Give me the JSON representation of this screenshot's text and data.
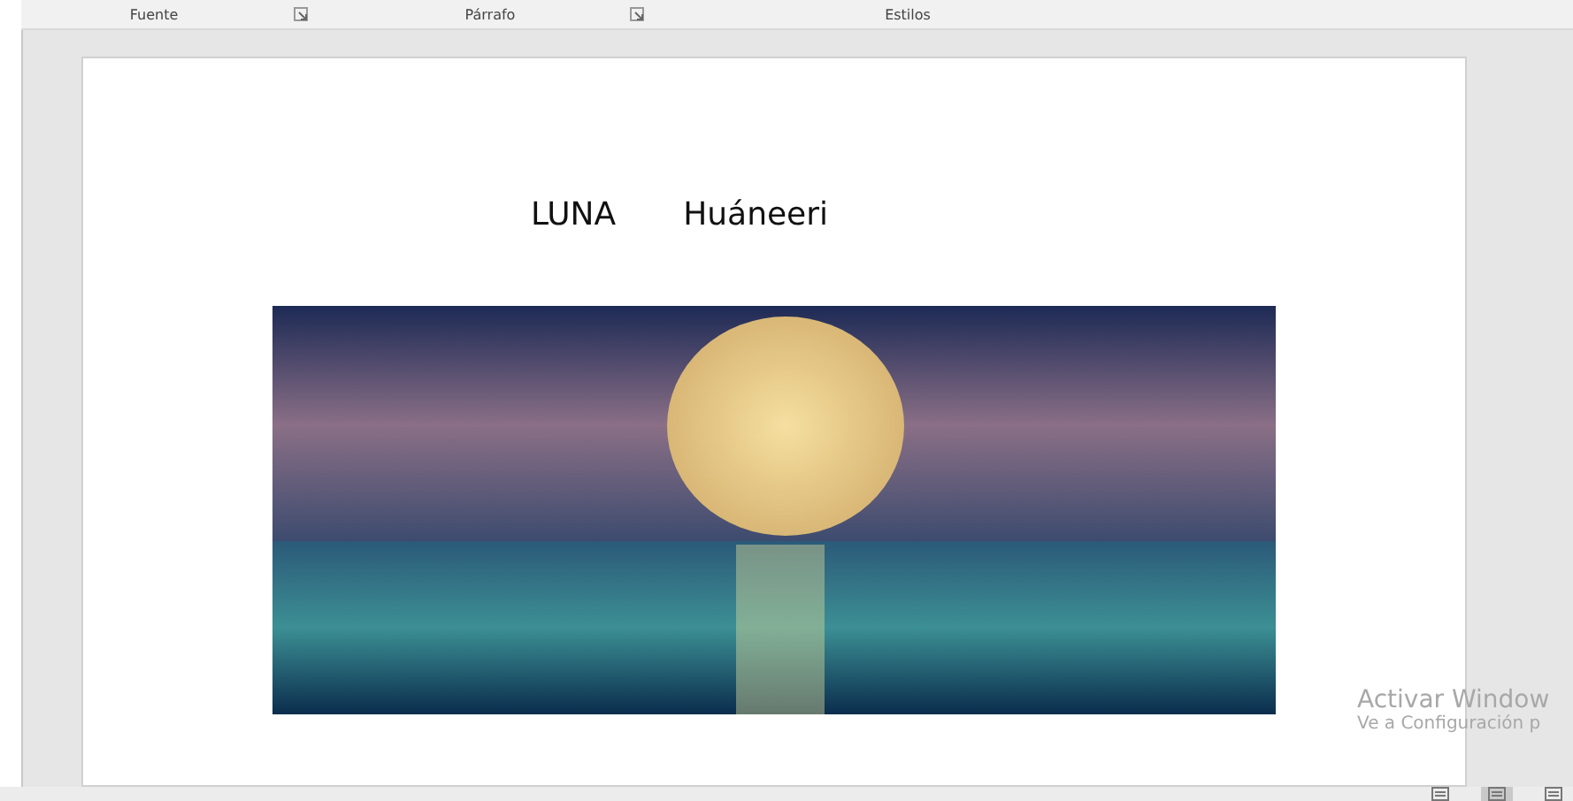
{
  "ribbon_groups": [
    {
      "label": "Fuente",
      "launcher": true
    },
    {
      "label": "Párrafo",
      "launcher": true
    },
    {
      "label": "Estilos",
      "launcher": false
    }
  ],
  "document": {
    "title_words": [
      "LUNA",
      "Huáneeri"
    ]
  },
  "activation_notice": {
    "title": "Activar Window",
    "subtitle": "Ve a Configuración p"
  },
  "status_bar": {
    "views": [
      {
        "selected": false
      },
      {
        "selected": true
      },
      {
        "selected": false
      }
    ]
  }
}
